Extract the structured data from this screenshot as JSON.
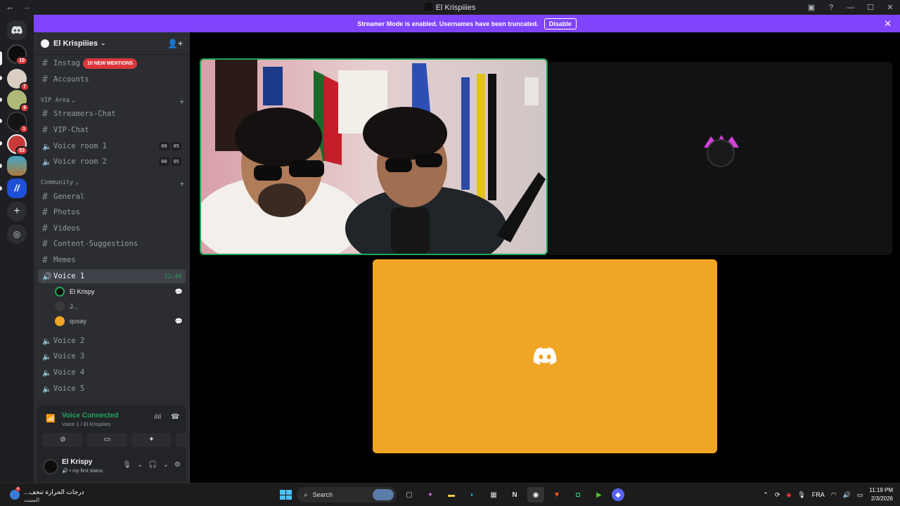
{
  "window": {
    "title": "El Krispiiies"
  },
  "banner": {
    "text": "Streamer Mode is enabled. Usernames have been truncated.",
    "button": "Disable"
  },
  "guilds": [
    {
      "badge": "10"
    },
    {
      "badge": "7"
    },
    {
      "badge": "9"
    },
    {
      "badge": "1"
    },
    {
      "badge": "53"
    }
  ],
  "server": {
    "name": "El Krispiiies",
    "mention_pill": "10 NEW MENTIONS",
    "channels_top": [
      {
        "name": "Instag"
      },
      {
        "name": "Accounts"
      }
    ],
    "categories": [
      {
        "name": "VIP Area"
      },
      {
        "name": "Community"
      }
    ],
    "vip_channels": [
      {
        "name": "Streamers-Chat",
        "type": "text"
      },
      {
        "name": "VIP-Chat",
        "type": "text"
      },
      {
        "name": "Voice room 1",
        "type": "voice",
        "tags": [
          "00",
          "05"
        ]
      },
      {
        "name": "Voice room 2",
        "type": "voice",
        "tags": [
          "00",
          "05"
        ]
      }
    ],
    "community_channels": [
      {
        "name": "General"
      },
      {
        "name": "Photos"
      },
      {
        "name": "Videos"
      },
      {
        "name": "Content-Suggestions"
      },
      {
        "name": "Memes"
      }
    ],
    "active_voice": {
      "name": "Voice 1",
      "time": "22:49"
    },
    "voice_users": [
      {
        "name": "El Krispy",
        "streaming": true
      },
      {
        "name": "J...",
        "streaming": false
      },
      {
        "name": "qusay",
        "streaming": true
      }
    ],
    "other_voice": [
      {
        "name": "Voice 2"
      },
      {
        "name": "Voice 3"
      },
      {
        "name": "Voice 4"
      },
      {
        "name": "Voice 5"
      }
    ]
  },
  "voice_panel": {
    "title": "Voice Connected",
    "subtitle": "Voice 1 / El Krispiiies"
  },
  "user": {
    "name": "El Krispy",
    "status": "my first status"
  },
  "taskbar": {
    "weather_line1": "درجات الحرارة تنخف...",
    "weather_line2": "السبت",
    "weather_badge": "4",
    "search": "Search",
    "lang": "FRA",
    "time": "11:19 PM",
    "date": "2/3/2026"
  },
  "colors": {
    "accent": "#5865f2",
    "streamer_banner": "#8044fd",
    "online": "#23a55a",
    "mention": "#da373c",
    "tile_orange": "#f0a526"
  }
}
